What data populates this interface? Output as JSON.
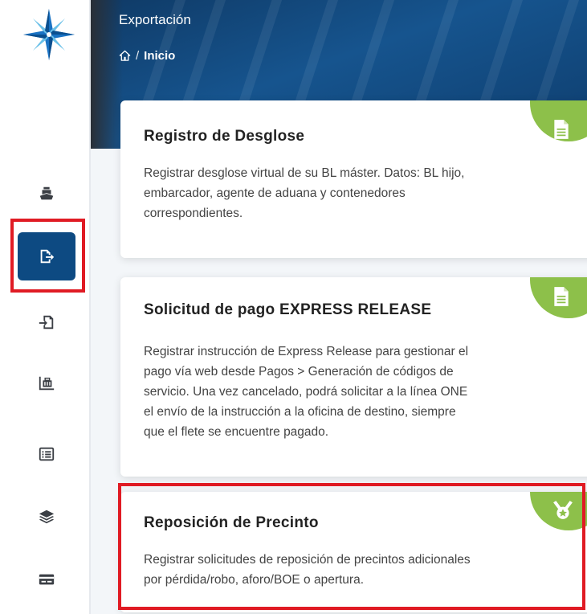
{
  "header": {
    "title": "Exportación",
    "breadcrumb_current": "Inicio",
    "breadcrumb_separator": "/"
  },
  "sidebar": {
    "items": [
      {
        "icon": "ship-icon",
        "active": false
      },
      {
        "icon": "export-icon",
        "active": true
      },
      {
        "icon": "import-icon",
        "active": false
      },
      {
        "icon": "cargo-trolley-icon",
        "active": false
      },
      {
        "icon": "list-icon",
        "active": false
      },
      {
        "icon": "layers-icon",
        "active": false
      },
      {
        "icon": "card-icon",
        "active": false
      }
    ]
  },
  "cards": [
    {
      "title": "Registro de Desglose",
      "desc_lines": [
        "Registrar desglose virtual de su BL máster. Datos: BL hijo,",
        "embarcador, agente de aduana y contenedores",
        "correspondientes."
      ],
      "icon": "document-icon"
    },
    {
      "title": "Solicitud de pago EXPRESS RELEASE",
      "desc_lines": [
        "Registrar instrucción de Express Release para gestionar el",
        "pago vía web desde Pagos > Generación de códigos de",
        "servicio. Una vez cancelado, podrá solicitar a la línea ONE",
        "el envío de la instrucción a la oficina de destino, siempre",
        "que el flete se encuentre pagado."
      ],
      "icon": "document-icon"
    },
    {
      "title": "Reposición de Precinto",
      "desc_lines": [
        "Registrar solicitudes de reposición de precintos adicionales",
        "por pérdida/robo, aforo/BOE o apertura."
      ],
      "icon": "medal-icon"
    }
  ],
  "colors": {
    "primary": "#0d4a82",
    "accent_green": "#8dc04a",
    "highlight_red": "#e01b24"
  }
}
